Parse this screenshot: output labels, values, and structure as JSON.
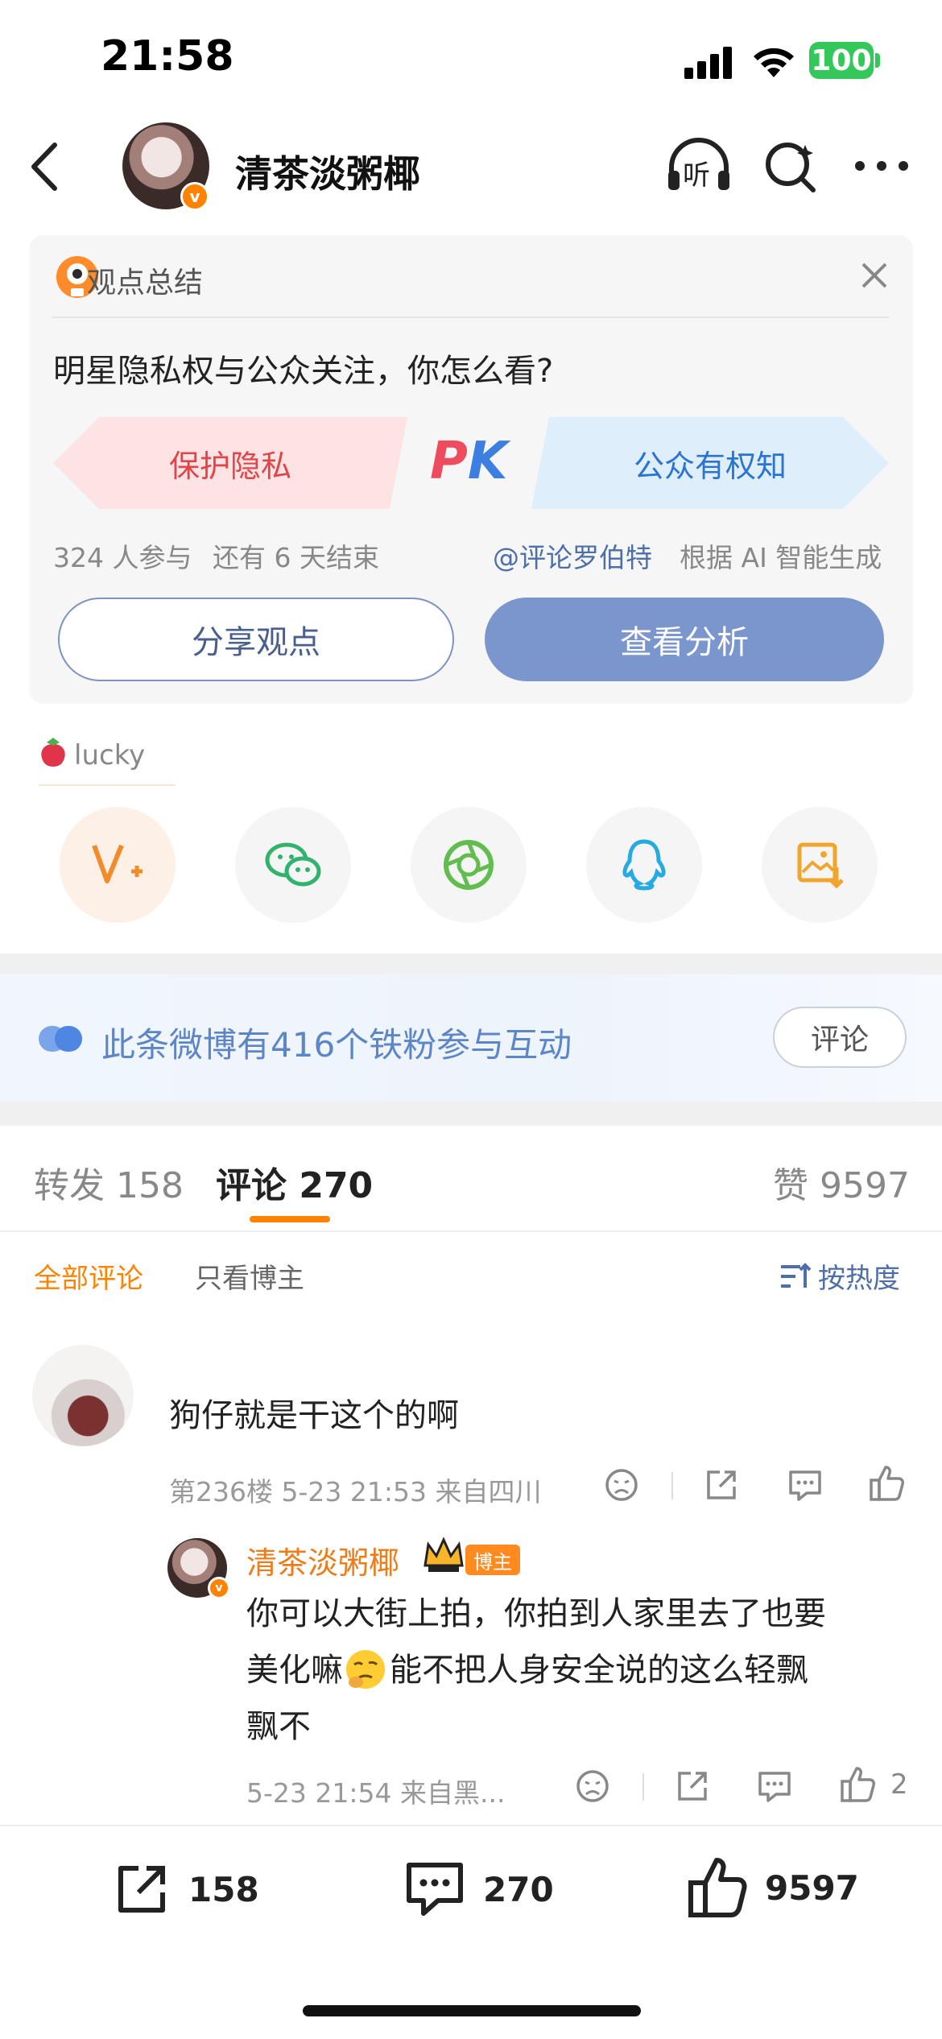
{
  "status_bar": {
    "time": "21:58",
    "battery": "100"
  },
  "nav": {
    "title": "清茶淡粥椰",
    "listen_label": "听"
  },
  "opinion_card": {
    "title": "观点总结",
    "question": "明星隐私权与公众关注，你怎么看?",
    "option_left": "保护隐私",
    "option_right": "公众有权知",
    "pk": "PK",
    "participants": "324 人参与",
    "remaining": "还有 6 天结束",
    "source_mention": "@评论罗伯特",
    "source_note": "根据 AI 智能生成",
    "share_button": "分享观点",
    "analysis_button": "查看分析"
  },
  "lucky": {
    "label": "lucky"
  },
  "share_targets": [
    "weibo-v-plus",
    "wechat",
    "moments",
    "qq",
    "save-image"
  ],
  "fans_banner": {
    "text": "此条微博有416个铁粉参与互动",
    "button": "评论"
  },
  "tabs": {
    "repost_label": "转发",
    "repost_count": "158",
    "comment_label": "评论",
    "comment_count": "270",
    "like_label": "赞",
    "like_count": "9597"
  },
  "filters": {
    "all": "全部评论",
    "host_only": "只看博主",
    "sort": "按热度"
  },
  "comments": [
    {
      "text": "狗仔就是干这个的啊",
      "meta": "第236楼 5-23 21:53 来自四川",
      "reply": {
        "name": "清茶淡粥椰",
        "badge": "博主",
        "text_line1": "你可以大街上拍，你拍到人家里去了也要",
        "text_line2_a": "美化嘛",
        "text_line2_b": "能不把人身安全说的这么轻飘",
        "text_line3": "飘不",
        "meta": "5-23 21:54 来自黑...",
        "likes": "2"
      }
    }
  ],
  "bottom_bar": {
    "reposts": "158",
    "comments": "270",
    "likes": "9597"
  },
  "colors": {
    "accent": "#ff8200",
    "link_blue": "#5d86c6",
    "pk_red": "#e0454a",
    "pk_blue": "#2a74d2"
  }
}
